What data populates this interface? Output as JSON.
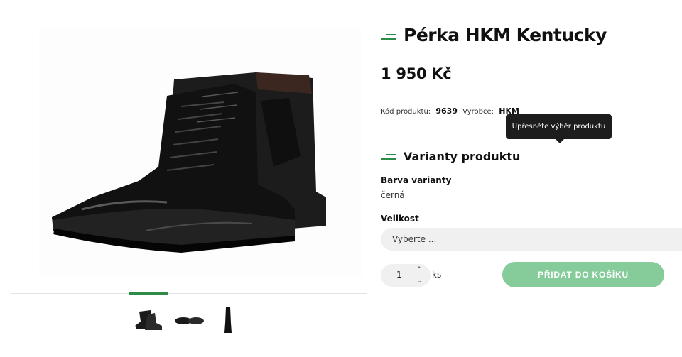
{
  "product": {
    "title": "Pérka HKM Kentucky",
    "price": "1 950 Kč",
    "code_label": "Kód produktu:",
    "code_value": "9639",
    "maker_label": "Výrobce:",
    "maker_value": "HKM"
  },
  "tooltip": {
    "text": "Upřesněte výběr produktu"
  },
  "variants": {
    "title": "Varianty produktu",
    "color_label": "Barva varianty",
    "color_value": "černá",
    "size_label": "Velikost",
    "size_placeholder": "Vyberte ..."
  },
  "cart": {
    "quantity": "1",
    "unit": "ks",
    "add_label": "PŘIDAT DO KOŠÍKU"
  },
  "icons": {
    "qty_up": "⌃",
    "qty_down": "⌄"
  },
  "colors": {
    "accent": "#2e8b46",
    "button": "#85cc9a",
    "tooltip": "#1d1d1d"
  }
}
